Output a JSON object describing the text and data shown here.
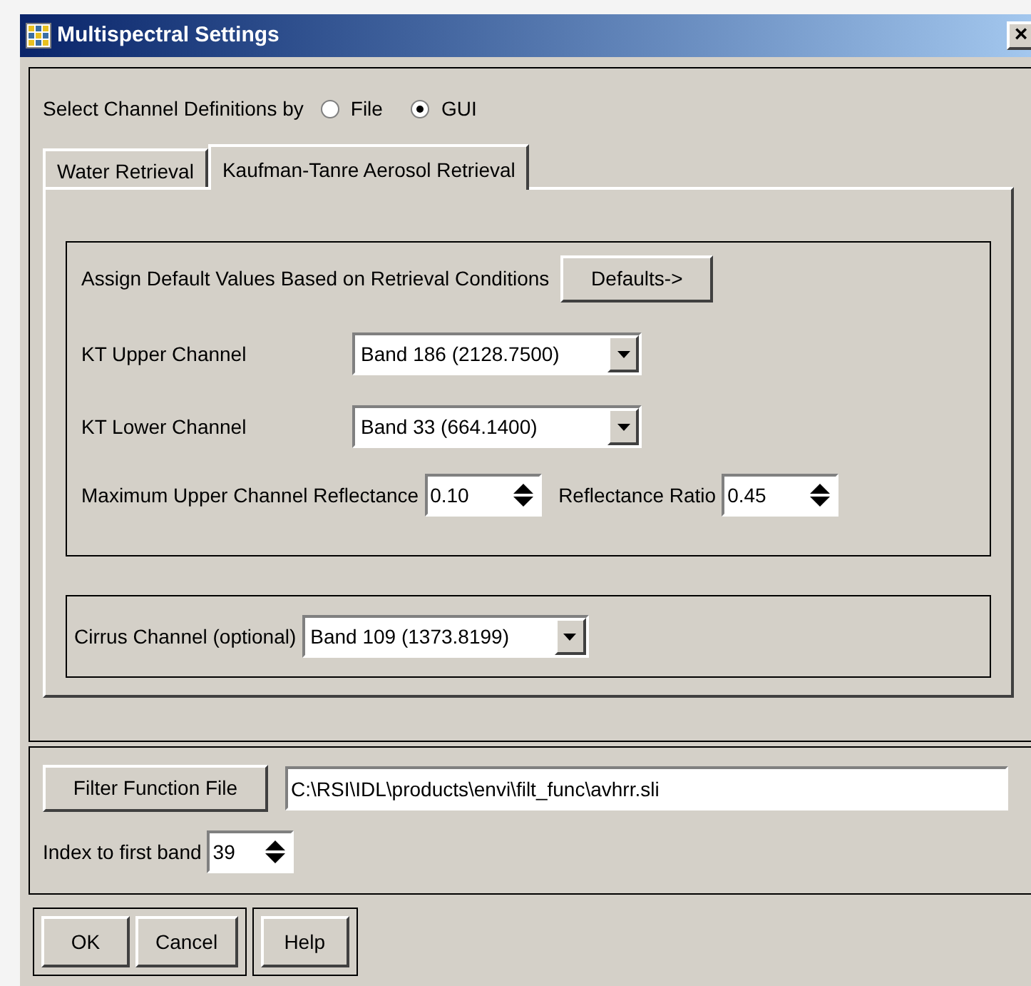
{
  "window": {
    "title": "Multispectral Settings",
    "close": "×"
  },
  "channel_definitions": {
    "label": "Select Channel Definitions by",
    "options": [
      {
        "label": "File",
        "selected": false
      },
      {
        "label": "GUI",
        "selected": true
      }
    ]
  },
  "tabs": [
    {
      "label": "Water Retrieval",
      "selected": false
    },
    {
      "label": "Kaufman-Tanre Aerosol Retrieval",
      "selected": true
    }
  ],
  "defaults": {
    "label": "Assign Default Values Based on Retrieval Conditions",
    "button": "Defaults->"
  },
  "channels": [
    {
      "label": "KT Upper Channel",
      "value": "Band 186 (2128.7500)"
    },
    {
      "label": "KT Lower Channel",
      "value": "Band 33 (664.1400)"
    }
  ],
  "reflectance": [
    {
      "label": "Maximum Upper Channel Reflectance",
      "value": "0.10"
    },
    {
      "label": "Reflectance Ratio",
      "value": "0.45"
    }
  ],
  "cirrus": {
    "label": "Cirrus Channel (optional)",
    "value": "Band 109 (1373.8199)"
  },
  "filter_function": {
    "button": "Filter Function File",
    "value": "C:\\RSI\\IDL\\products\\envi\\filt_func\\avhrr.sli"
  },
  "first_band": {
    "label": "Index to first band",
    "value": "39"
  },
  "button_groups": [
    [
      "OK",
      "Cancel"
    ],
    [
      "Help"
    ]
  ]
}
